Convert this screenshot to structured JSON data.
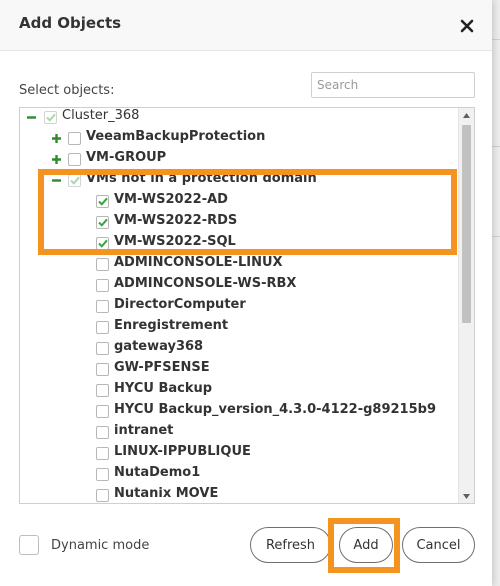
{
  "dialog": {
    "title": "Add Objects",
    "close_icon": "close-icon"
  },
  "select_label": "Select objects:",
  "search": {
    "placeholder": "Search",
    "value": ""
  },
  "tree": {
    "root": {
      "label": "Cluster_368",
      "expander": "minus",
      "checked": "partial"
    },
    "groups": [
      {
        "label": "VeeamBackupProtection",
        "expander": "plus",
        "checked": false
      },
      {
        "label": "VM-GROUP",
        "expander": "plus",
        "checked": false
      },
      {
        "label": "VMs not in a protection domain",
        "expander": "minus",
        "checked": "partial"
      }
    ],
    "vms": [
      {
        "label": "VM-WS2022-AD",
        "checked": true
      },
      {
        "label": "VM-WS2022-RDS",
        "checked": true
      },
      {
        "label": "VM-WS2022-SQL",
        "checked": true
      },
      {
        "label": "ADMINCONSOLE-LINUX",
        "checked": false
      },
      {
        "label": "ADMINCONSOLE-WS-RBX",
        "checked": false
      },
      {
        "label": "DirectorComputer",
        "checked": false
      },
      {
        "label": "Enregistrement",
        "checked": false
      },
      {
        "label": "gateway368",
        "checked": false
      },
      {
        "label": "GW-PFSENSE",
        "checked": false
      },
      {
        "label": "HYCU Backup",
        "checked": false
      },
      {
        "label": "HYCU Backup_version_4.3.0-4122-g89215b9",
        "checked": false
      },
      {
        "label": "intranet",
        "checked": false
      },
      {
        "label": "LINUX-IPPUBLIQUE",
        "checked": false
      },
      {
        "label": "NutaDemo1",
        "checked": false
      },
      {
        "label": "Nutanix MOVE",
        "checked": false
      }
    ]
  },
  "dynamic_mode": {
    "label": "Dynamic mode",
    "checked": false
  },
  "buttons": {
    "refresh": "Refresh",
    "add": "Add",
    "cancel": "Cancel"
  },
  "colors": {
    "highlight": "#f4931f",
    "check_green": "#3aa33a",
    "expander_green": "#2e8b2e"
  }
}
